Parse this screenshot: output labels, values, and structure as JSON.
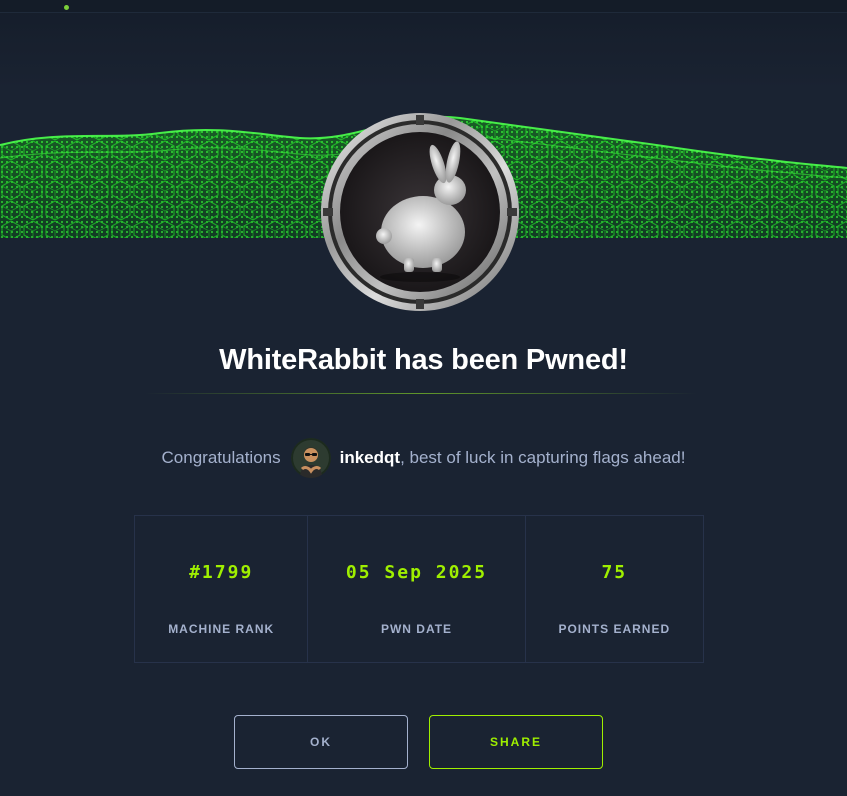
{
  "header": {
    "title": "WhiteRabbit has been Pwned!"
  },
  "banner": {
    "machine_badge_icon": "rabbit-icon",
    "accent_color": "#9fef00",
    "wave_color": "#22d622"
  },
  "congrats": {
    "prefix": "Congratulations",
    "username": "inkedqt",
    "suffix": ", best of luck in capturing flags ahead!"
  },
  "stats": [
    {
      "value": "#1799",
      "label": "MACHINE RANK"
    },
    {
      "value": "05 Sep 2025",
      "label": "PWN DATE"
    },
    {
      "value": "75",
      "label": "POINTS EARNED"
    }
  ],
  "actions": {
    "ok_label": "OK",
    "share_label": "SHARE"
  },
  "colors": {
    "background": "#1a2332",
    "text_muted": "#a4b1cd",
    "border": "#27324a",
    "badge_ring_accent": "#e0141e"
  }
}
